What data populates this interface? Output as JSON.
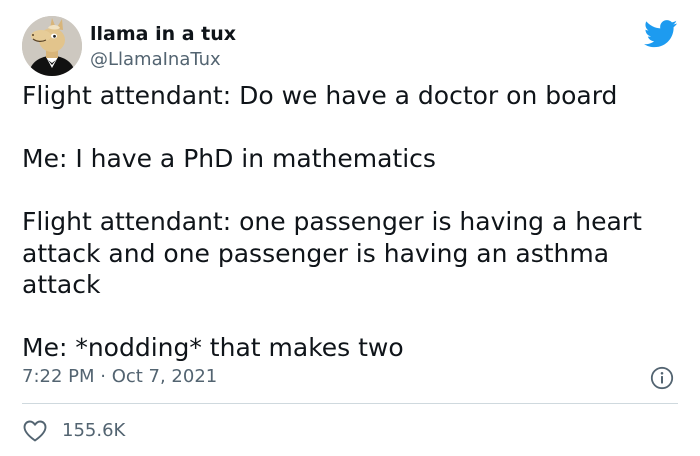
{
  "author": {
    "display_name": "llama in a tux",
    "handle": "@LlamaInaTux"
  },
  "tweet": {
    "paragraphs": [
      "Flight attendant: Do we have a doctor on board",
      "Me: I have a PhD in mathematics",
      "Flight attendant: one passenger is having a heart attack and one passenger is having an asthma attack",
      "Me: *nodding* that makes two"
    ],
    "timestamp": "7:22 PM · Oct 7, 2021",
    "likes": "155.6K"
  },
  "icons": {
    "brand": "twitter-bird-icon",
    "info": "info-icon",
    "like": "heart-icon"
  },
  "colors": {
    "brand_blue": "#1d9bf0",
    "text_primary": "#0f1419",
    "text_secondary": "#536471",
    "divider": "#cfd9de"
  }
}
